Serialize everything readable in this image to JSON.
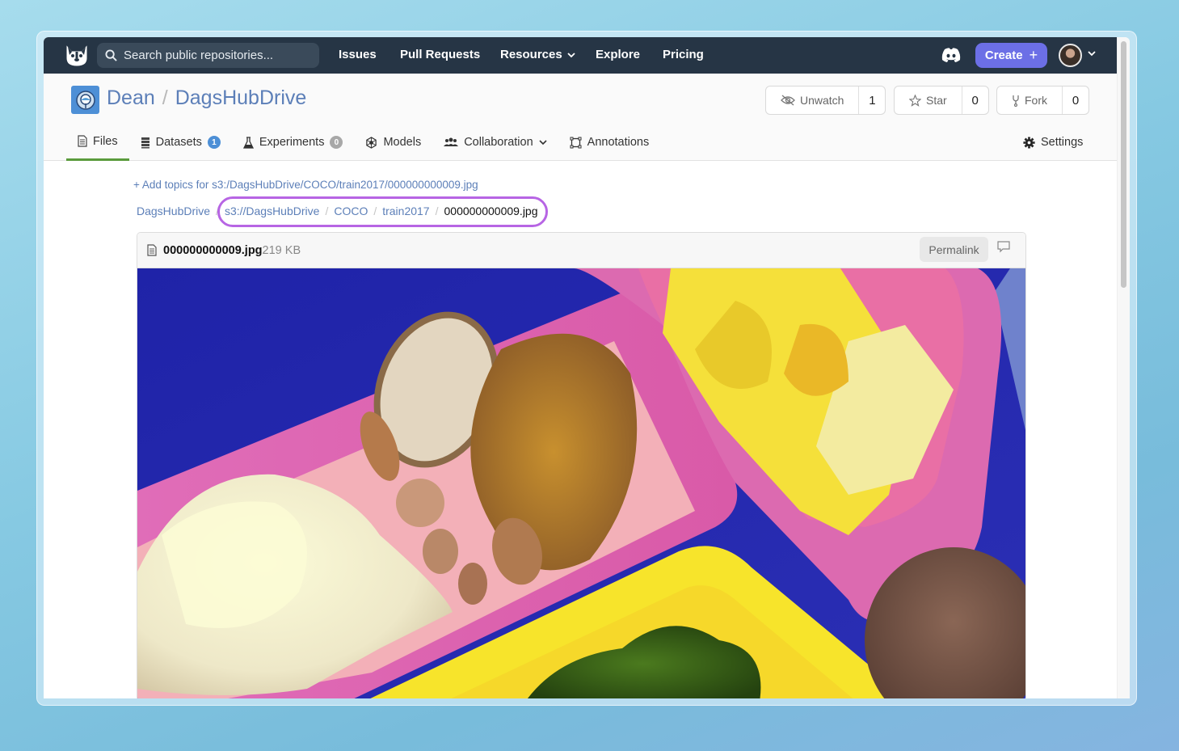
{
  "nav": {
    "search_placeholder": "Search public repositories...",
    "links": [
      "Issues",
      "Pull Requests",
      "Resources",
      "Explore",
      "Pricing"
    ],
    "create_label": "Create"
  },
  "repo": {
    "owner": "Dean",
    "name": "DagsHubDrive",
    "watch": {
      "label": "Unwatch",
      "count": "1"
    },
    "star": {
      "label": "Star",
      "count": "0"
    },
    "fork": {
      "label": "Fork",
      "count": "0"
    }
  },
  "tabs": [
    {
      "label": "Files",
      "active": true
    },
    {
      "label": "Datasets",
      "badge": "1"
    },
    {
      "label": "Experiments",
      "badge": "0"
    },
    {
      "label": "Models"
    },
    {
      "label": "Collaboration"
    },
    {
      "label": "Annotations"
    }
  ],
  "settings_label": "Settings",
  "add_topics": "+ Add topics for s3:/DagsHubDrive/COCO/train2017/000000000009.jpg",
  "breadcrumb": [
    "DagsHubDrive",
    "s3://DagsHubDrive",
    "COCO",
    "train2017",
    "000000000009.jpg"
  ],
  "file": {
    "name": "000000000009.jpg",
    "size": "219 KB",
    "permalink_label": "Permalink"
  },
  "colors": {
    "nav_bg": "#263545",
    "create_btn": "#6c6fe6",
    "link": "#5c7fb8",
    "active_tab": "#5a9b3c",
    "highlight": "#b765e4",
    "badge_blue": "#4d8fd6",
    "badge_gray": "#a8a8a8"
  }
}
